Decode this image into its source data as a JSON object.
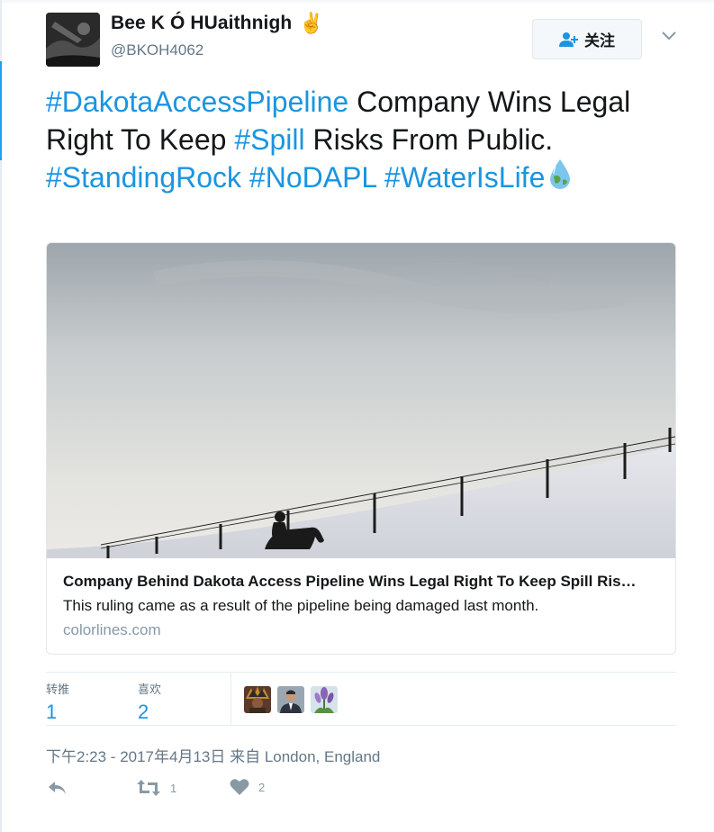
{
  "user": {
    "display_name": "Bee K Ó HUaithnigh",
    "badge_emoji": "✌",
    "handle": "@BKOH4062"
  },
  "follow_button": {
    "label": "关注"
  },
  "tweet": {
    "segments": [
      {
        "text": "#DakotaAccessPipeline",
        "hashtag": true
      },
      {
        "text": " Company Wins Legal Right To Keep ",
        "hashtag": false
      },
      {
        "text": "#Spill",
        "hashtag": true
      },
      {
        "text": " Risks From Public. ",
        "hashtag": false
      },
      {
        "text": "#StandingRock",
        "hashtag": true
      },
      {
        "text": " ",
        "hashtag": false
      },
      {
        "text": "#NoDAPL",
        "hashtag": true
      },
      {
        "text": " ",
        "hashtag": false
      },
      {
        "text": "#WaterIsLife",
        "hashtag": true
      }
    ],
    "emoji": "earth-water-drop"
  },
  "card": {
    "title": "Company Behind Dakota Access Pipeline Wins Legal Right To Keep Spill Ris…",
    "description": "This ruling came as a result of the pipeline being damaged last month.",
    "domain": "colorlines.com",
    "image": "rider-on-horse-snowy-hill-fence"
  },
  "stats": {
    "retweets": {
      "label": "转推",
      "value": "1"
    },
    "likes": {
      "label": "喜欢",
      "value": "2"
    },
    "likers": [
      "liker-avatar-headdress",
      "liker-avatar-man-suit",
      "liker-avatar-flowers"
    ]
  },
  "timestamp": "下午2:23 - 2017年4月13日 来自 London, England",
  "actions": {
    "reply_icon": "reply-icon",
    "retweet_icon": "retweet-icon",
    "retweet_count": "1",
    "like_icon": "heart-icon",
    "like_count": "2"
  },
  "colors": {
    "link": "#1b95e0",
    "text": "#14171a",
    "muted": "#657786",
    "border": "#e1e8ed"
  }
}
